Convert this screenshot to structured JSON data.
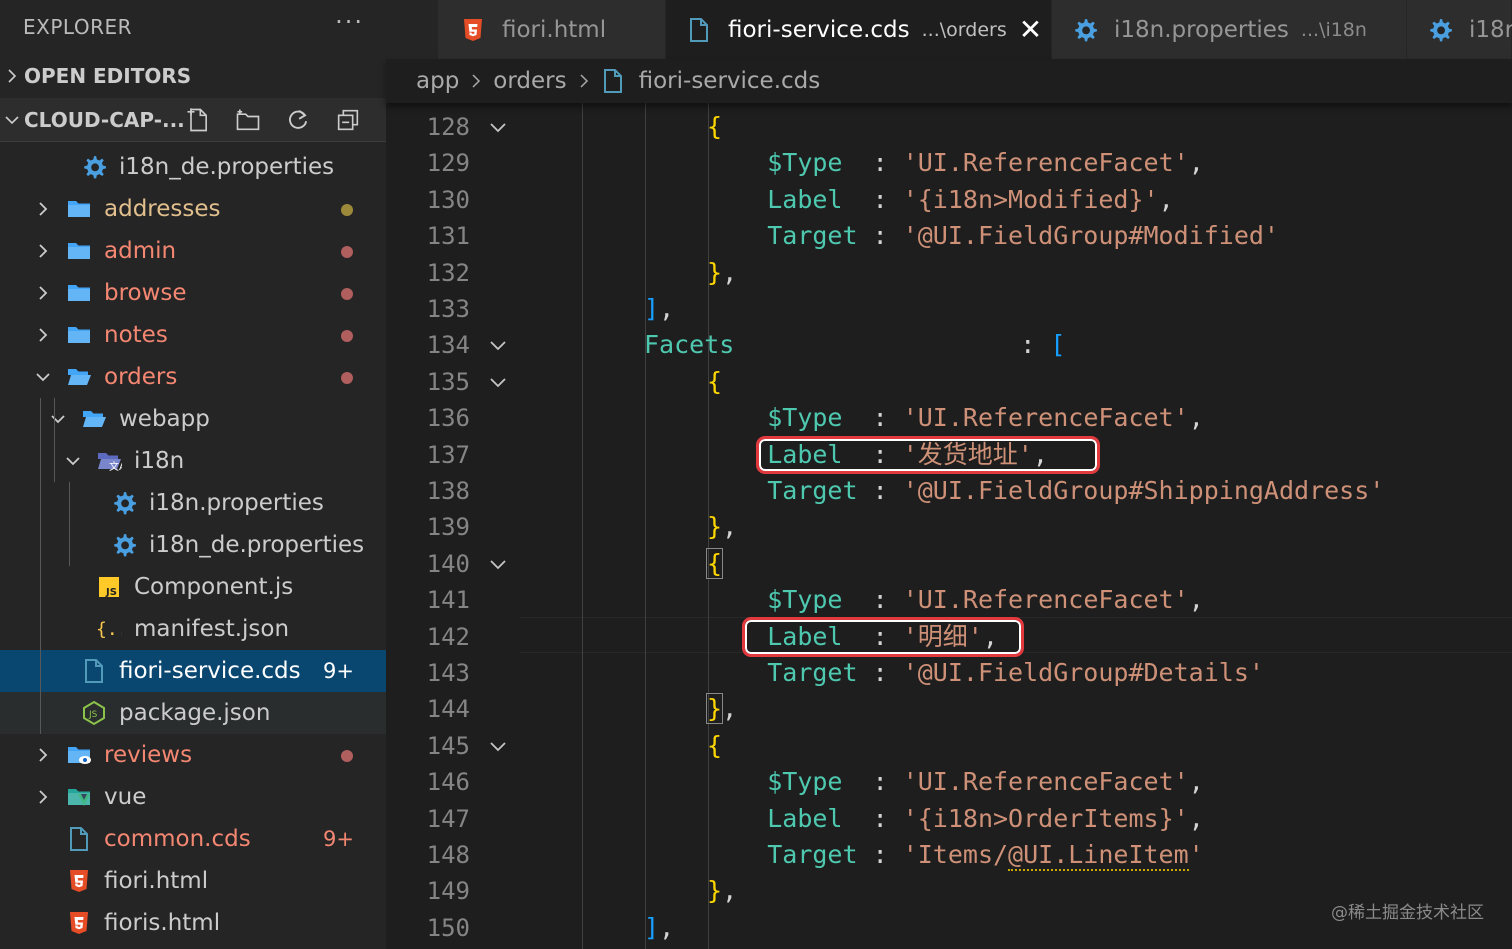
{
  "explorer": {
    "title": "EXPLORER",
    "more_label": "···",
    "open_editors_label": "OPEN EDITORS",
    "workspace_label": "CLOUD-CAP-..."
  },
  "tree": [
    {
      "label": "i18n_de.properties",
      "icon": "gear-icon",
      "indent": 1,
      "twisty": "none",
      "state": "normal"
    },
    {
      "label": "addresses",
      "icon": "folder-icon",
      "indent": 0,
      "twisty": "collapsed",
      "state": "mod",
      "dot": "yellow"
    },
    {
      "label": "admin",
      "icon": "folder-icon",
      "indent": 0,
      "twisty": "collapsed",
      "state": "err",
      "dot": "red"
    },
    {
      "label": "browse",
      "icon": "folder-icon",
      "indent": 0,
      "twisty": "collapsed",
      "state": "err",
      "dot": "red"
    },
    {
      "label": "notes",
      "icon": "folder-icon",
      "indent": 0,
      "twisty": "collapsed",
      "state": "err",
      "dot": "red"
    },
    {
      "label": "orders",
      "icon": "folder-open-icon",
      "indent": 0,
      "twisty": "expanded",
      "state": "err",
      "dot": "red"
    },
    {
      "label": "webapp",
      "icon": "folder-open-icon",
      "indent": 1,
      "twisty": "expanded",
      "state": "normal"
    },
    {
      "label": "i18n",
      "icon": "i18n-folder-icon",
      "indent": 2,
      "twisty": "expanded",
      "state": "normal"
    },
    {
      "label": "i18n.properties",
      "icon": "gear-icon",
      "indent": 3,
      "twisty": "none",
      "state": "normal"
    },
    {
      "label": "i18n_de.properties",
      "icon": "gear-icon",
      "indent": 3,
      "twisty": "none",
      "state": "normal"
    },
    {
      "label": "Component.js",
      "icon": "js-icon",
      "indent": 2,
      "twisty": "none",
      "state": "normal"
    },
    {
      "label": "manifest.json",
      "icon": "json-icon",
      "indent": 2,
      "twisty": "none",
      "state": "normal"
    },
    {
      "label": "fiori-service.cds",
      "icon": "file-icon",
      "indent": 1,
      "twisty": "none",
      "state": "active",
      "badge": "9+"
    },
    {
      "label": "package.json",
      "icon": "nodejs-icon",
      "indent": 1,
      "twisty": "none",
      "state": "hover"
    },
    {
      "label": "reviews",
      "icon": "folder-eye-icon",
      "indent": 0,
      "twisty": "collapsed",
      "state": "err",
      "dot": "red"
    },
    {
      "label": "vue",
      "icon": "vue-folder-icon",
      "indent": 0,
      "twisty": "collapsed",
      "state": "normal"
    },
    {
      "label": "common.cds",
      "icon": "file-icon",
      "indent": 0,
      "twisty": "none",
      "state": "err",
      "badge": "9+"
    },
    {
      "label": "fiori.html",
      "icon": "html5-icon",
      "indent": 0,
      "twisty": "none",
      "state": "normal"
    },
    {
      "label": "fioris.html",
      "icon": "html5-icon",
      "indent": 0,
      "twisty": "none",
      "state": "normal"
    }
  ],
  "tabs": [
    {
      "label": "fiori.html",
      "desc": "",
      "icon": "html5-icon",
      "active": false
    },
    {
      "label": "fiori-service.cds",
      "desc": "...\\orders",
      "icon": "file-icon",
      "active": true,
      "close": "✕"
    },
    {
      "label": "i18n.properties",
      "desc": "...\\i18n",
      "icon": "gear-icon",
      "active": false
    },
    {
      "label": "i18r",
      "desc": "",
      "icon": "gear-icon",
      "active": false
    }
  ],
  "breadcrumbs": {
    "part1": "app",
    "part2": "orders",
    "part3": "fiori-service.cds"
  },
  "editor": {
    "line_numbers": [
      "128",
      "129",
      "130",
      "131",
      "132",
      "133",
      "134",
      "135",
      "136",
      "137",
      "138",
      "139",
      "140",
      "141",
      "142",
      "143",
      "144",
      "145",
      "146",
      "147",
      "148",
      "149",
      "150"
    ],
    "folds": [
      128,
      134,
      135,
      140,
      145
    ],
    "lines": [
      [
        {
          "t": "{",
          "c": "br"
        }
      ],
      [
        {
          "t": "    "
        },
        {
          "t": "$Type",
          "c": "k"
        },
        {
          "t": "  : ",
          "c": "p"
        },
        {
          "t": "'UI.ReferenceFacet'",
          "c": "s"
        },
        {
          "t": ",",
          "c": "p"
        }
      ],
      [
        {
          "t": "    "
        },
        {
          "t": "Label",
          "c": "k"
        },
        {
          "t": "  : ",
          "c": "p"
        },
        {
          "t": "'{i18n>Modified}'",
          "c": "s"
        },
        {
          "t": ",",
          "c": "p"
        }
      ],
      [
        {
          "t": "    "
        },
        {
          "t": "Target",
          "c": "k"
        },
        {
          "t": " : ",
          "c": "p"
        },
        {
          "t": "'@UI.FieldGroup#Modified'",
          "c": "s"
        }
      ],
      [
        {
          "t": "}",
          "c": "br"
        },
        {
          "t": ",",
          "c": "p"
        }
      ],
      [
        {
          "t": "]",
          "c": "bb"
        },
        {
          "t": ",",
          "c": "p"
        }
      ],
      [
        {
          "t": "Facets",
          "c": "k"
        },
        {
          "t": "                   : ",
          "c": "p"
        },
        {
          "t": "[",
          "c": "bb"
        }
      ],
      [
        {
          "t": "{",
          "c": "br"
        }
      ],
      [
        {
          "t": "    "
        },
        {
          "t": "$Type",
          "c": "k"
        },
        {
          "t": "  : ",
          "c": "p"
        },
        {
          "t": "'UI.ReferenceFacet'",
          "c": "s"
        },
        {
          "t": ",",
          "c": "p"
        }
      ],
      [
        {
          "t": "    "
        },
        {
          "t": "Label",
          "c": "k"
        },
        {
          "t": "  : ",
          "c": "p"
        },
        {
          "t": "'发货地址'",
          "c": "s"
        },
        {
          "t": ",",
          "c": "p"
        }
      ],
      [
        {
          "t": "    "
        },
        {
          "t": "Target",
          "c": "k"
        },
        {
          "t": " : ",
          "c": "p"
        },
        {
          "t": "'@UI.FieldGroup#ShippingAddress'",
          "c": "s"
        }
      ],
      [
        {
          "t": "}",
          "c": "br"
        },
        {
          "t": ",",
          "c": "p"
        }
      ],
      [
        {
          "t": "{",
          "c": "br bracket-match"
        }
      ],
      [
        {
          "t": "    "
        },
        {
          "t": "$Type",
          "c": "k"
        },
        {
          "t": "  : ",
          "c": "p"
        },
        {
          "t": "'UI.ReferenceFacet'",
          "c": "s"
        },
        {
          "t": ",",
          "c": "p"
        }
      ],
      [
        {
          "t": "    "
        },
        {
          "t": "Label",
          "c": "k"
        },
        {
          "t": "  : ",
          "c": "p"
        },
        {
          "t": "'明细'",
          "c": "s"
        },
        {
          "t": ",",
          "c": "p"
        }
      ],
      [
        {
          "t": "    "
        },
        {
          "t": "Target",
          "c": "k"
        },
        {
          "t": " : ",
          "c": "p"
        },
        {
          "t": "'@UI.FieldGroup#Details'",
          "c": "s"
        }
      ],
      [
        {
          "t": "}",
          "c": "br bracket-match"
        },
        {
          "t": ",",
          "c": "p"
        }
      ],
      [
        {
          "t": "{",
          "c": "br"
        }
      ],
      [
        {
          "t": "    "
        },
        {
          "t": "$Type",
          "c": "k"
        },
        {
          "t": "  : ",
          "c": "p"
        },
        {
          "t": "'UI.ReferenceFacet'",
          "c": "s"
        },
        {
          "t": ",",
          "c": "p"
        }
      ],
      [
        {
          "t": "    "
        },
        {
          "t": "Label",
          "c": "k"
        },
        {
          "t": "  : ",
          "c": "p"
        },
        {
          "t": "'{i18n>OrderItems}'",
          "c": "s"
        },
        {
          "t": ",",
          "c": "p"
        }
      ],
      [
        {
          "t": "    "
        },
        {
          "t": "Target",
          "c": "k"
        },
        {
          "t": " : ",
          "c": "p"
        },
        {
          "t": "'Items/",
          "c": "s"
        },
        {
          "t": "@UI.LineItem",
          "c": "s squig"
        },
        {
          "t": "'",
          "c": "s"
        }
      ],
      [
        {
          "t": "}",
          "c": "br"
        },
        {
          "t": ",",
          "c": "p"
        }
      ],
      [
        {
          "t": "]",
          "c": "bb"
        },
        {
          "t": ",",
          "c": "p"
        }
      ]
    ],
    "indent_levels": [
      2,
      2,
      2,
      2,
      2,
      1,
      1,
      2,
      2,
      2,
      2,
      2,
      2,
      2,
      2,
      2,
      2,
      2,
      2,
      2,
      2,
      2,
      1
    ]
  },
  "watermark": "@稀土掘金技术社区",
  "colors": {
    "accent_active": "#094771",
    "highlight_box": "#e0393e"
  }
}
